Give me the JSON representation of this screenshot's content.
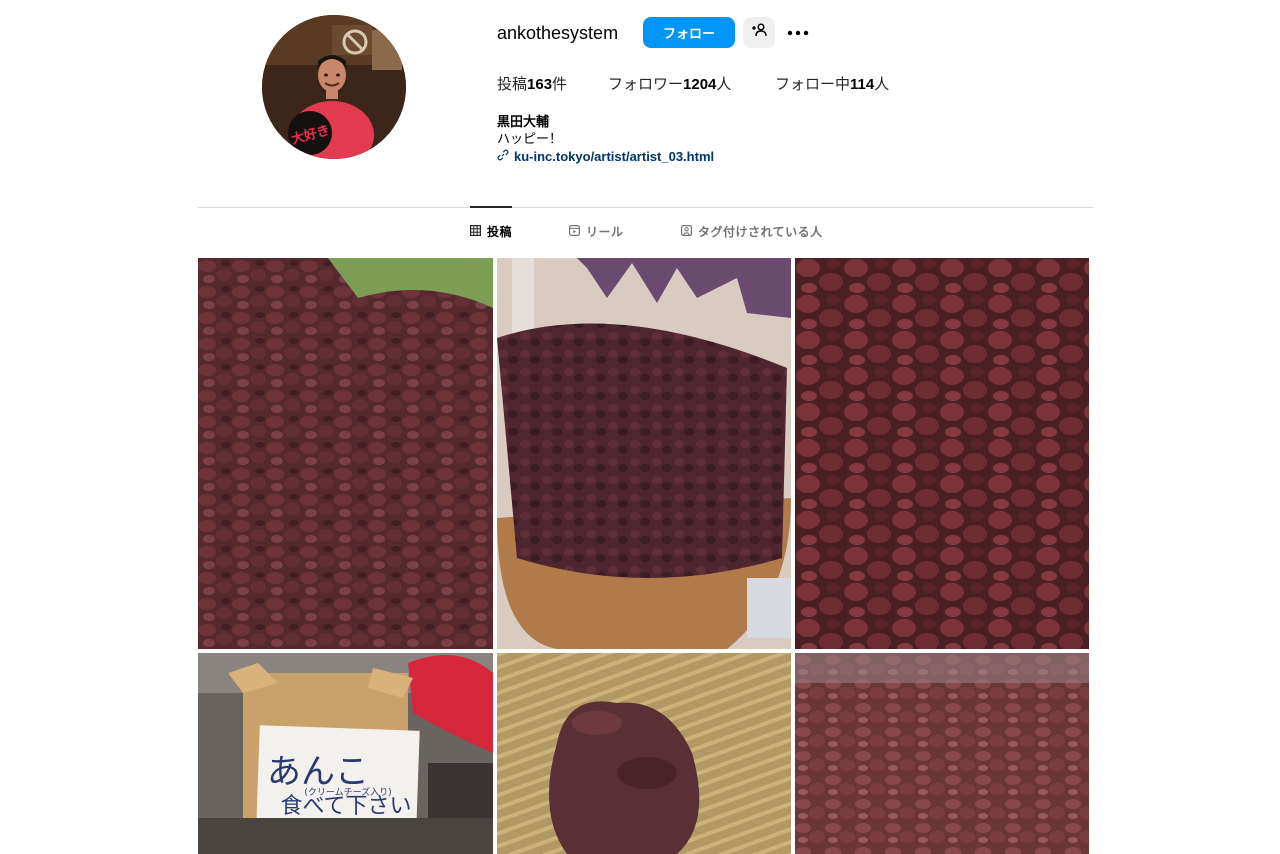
{
  "profile": {
    "username": "ankothesystem",
    "follow_label": "フォロー",
    "full_name": "黒田大輔",
    "bio": "ハッピー！",
    "link": "ku-inc.tokyo/artist/artist_03.html",
    "avatar_sign_text": "大好き"
  },
  "stats": {
    "posts_prefix": "投稿",
    "posts_count": "163",
    "posts_suffix": "件",
    "followers_prefix": "フォロワー",
    "followers_count": "1204",
    "followers_suffix": "人",
    "following_prefix": "フォロー中",
    "following_count": "114",
    "following_suffix": "人"
  },
  "tabs": {
    "posts": "投稿",
    "reels": "リール",
    "tagged": "タグ付けされている人"
  },
  "posts": {
    "sign_line1": "あんこ",
    "sign_line2": "(クリームチーズ入り)",
    "sign_line3": "食べて下さい"
  },
  "colors": {
    "accent": "#0095f6",
    "link": "#00376b",
    "anko_dark": "#4a2228",
    "anko_mid": "#6b3036"
  },
  "icons": {
    "suggest": "person-plus-icon",
    "more": "more-icon",
    "link": "link-icon",
    "grid": "grid-icon",
    "reels": "reels-icon",
    "tagged": "tagged-icon"
  }
}
